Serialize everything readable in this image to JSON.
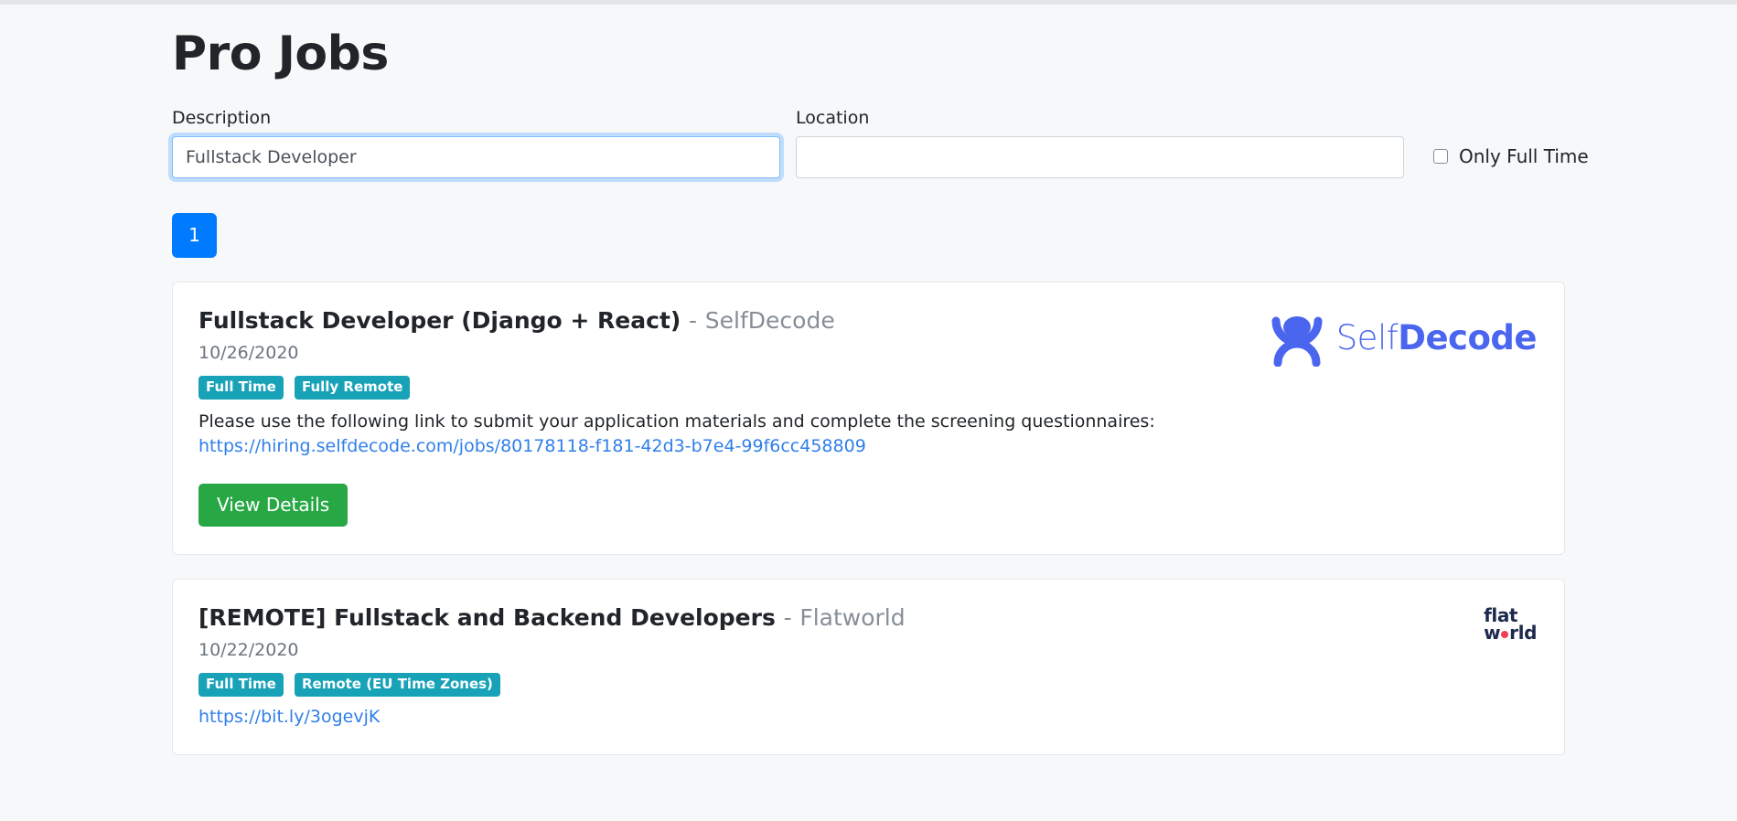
{
  "page": {
    "title": "Pro Jobs"
  },
  "search": {
    "description_label": "Description",
    "description_value": "Fullstack Developer",
    "description_placeholder": "",
    "location_label": "Location",
    "location_value": "",
    "location_placeholder": "",
    "only_full_time_label": "Only Full Time",
    "only_full_time_checked": false
  },
  "pagination": {
    "current_page": "1",
    "pages": [
      "1"
    ]
  },
  "colors": {
    "accent_blue": "#007bff",
    "badge_teal": "#17a2b8",
    "button_green": "#28a745",
    "link_blue": "#2f7fea",
    "selfdecode_blue": "#4a66ef",
    "flatworld_navy": "#1d2a4d",
    "flatworld_dot_red": "#ef4056",
    "page_background": "#f6f8fa"
  },
  "jobs": [
    {
      "title": "Fullstack Developer (Django + React)",
      "separator": "-",
      "company": "SelfDecode",
      "date": "10/26/2020",
      "badges": [
        "Full Time",
        "Fully Remote"
      ],
      "description_text": "Please use the following link to submit your application materials and complete the screening questionnaires: ",
      "description_link": "https://hiring.selfdecode.com/jobs/80178118-f181-42d3-b7e4-99f6cc458809",
      "action_label": "View Details",
      "logo": {
        "type": "selfdecode-logo",
        "word_light": "Self",
        "word_bold": "Decode"
      }
    },
    {
      "title": "[REMOTE] Fullstack and Backend Developers",
      "separator": "-",
      "company": "Flatworld",
      "date": "10/22/2020",
      "badges": [
        "Full Time",
        "Remote (EU Time Zones)"
      ],
      "description_text": "",
      "description_link": "https://bit.ly/3ogevjK",
      "action_label": "",
      "logo": {
        "type": "flatworld-logo",
        "word_top": "flat",
        "word_bottom_left": "w",
        "word_bottom_right": "rld"
      }
    }
  ]
}
